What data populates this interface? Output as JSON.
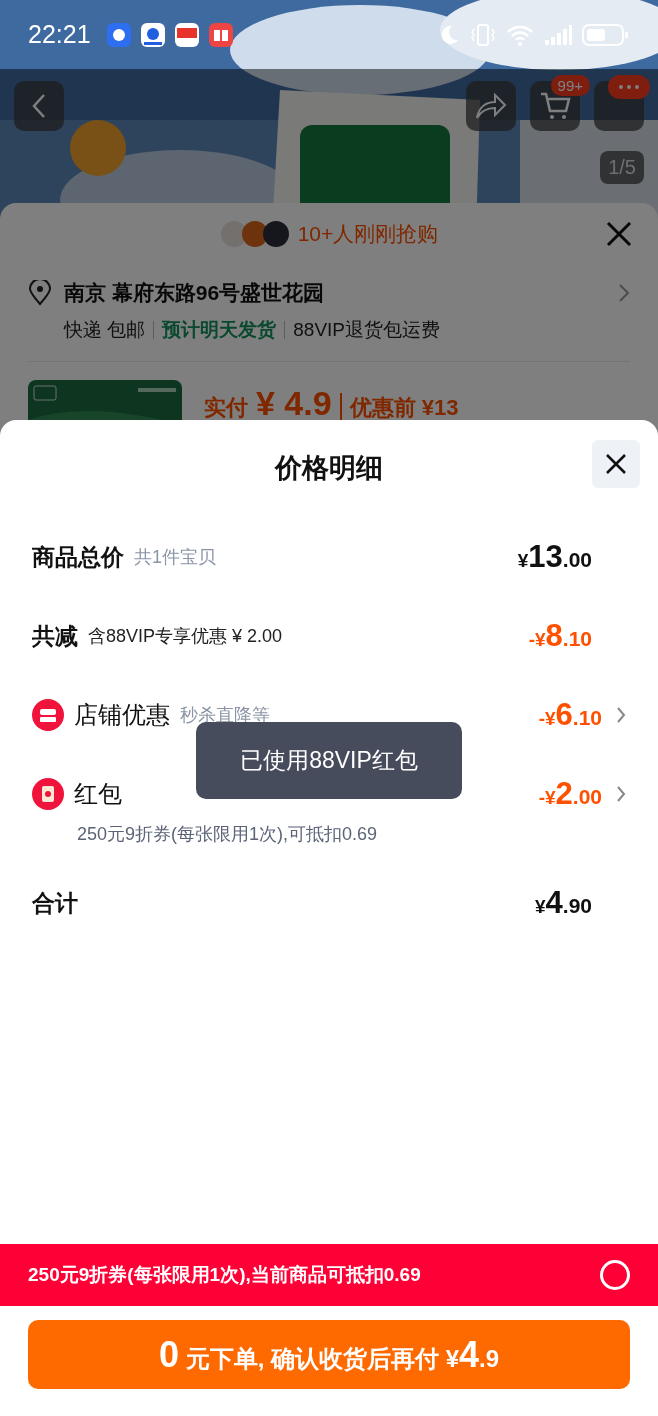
{
  "status_bar": {
    "time": "22:21"
  },
  "header": {
    "cart_badge": "99+",
    "photo_counter": "1/5"
  },
  "order_sheet": {
    "buyers_note": "10+人刚刚抢购",
    "address": "南京 幕府东路96号盛世花园",
    "shipping": [
      {
        "text": "快递 包邮",
        "kind": "plain"
      },
      {
        "text": "预计明天发货",
        "kind": "highlight"
      },
      {
        "text": "88VIP退货包运费",
        "kind": "plain"
      }
    ],
    "paid_label": "实付",
    "paid_price": "¥ 4.9",
    "original_price": "优惠前 ¥13"
  },
  "price_sheet": {
    "title": "价格明细",
    "rows": [
      {
        "kind": "sum",
        "label": "商品总价",
        "note": "共1件宝贝",
        "price": {
          "prefix": "¥",
          "major": "13",
          "minor": ".00"
        }
      },
      {
        "kind": "reduction",
        "label": "共减",
        "note": "含88VIP专享优惠 ¥ 2.00",
        "price": {
          "prefix": "-¥",
          "major": "8",
          "minor": ".10"
        }
      },
      {
        "kind": "store",
        "label": "店铺优惠",
        "note": "秒杀直降等",
        "price": {
          "prefix": "-¥",
          "major": "6",
          "minor": ".10"
        }
      },
      {
        "kind": "packet",
        "label": "红包",
        "detail": "250元9折券(每张限用1次),可抵扣0.69",
        "price": {
          "prefix": "-¥",
          "major": "2",
          "minor": ".00"
        }
      },
      {
        "kind": "total",
        "label": "合计",
        "price": {
          "prefix": "¥",
          "major": "4",
          "minor": ".90"
        }
      }
    ],
    "toast": "已使用88VIP红包"
  },
  "coupon_bar": {
    "text": "250元9折券(每张限用1次),当前商品可抵扣0.69",
    "selected": false
  },
  "confirm_button": {
    "segments": [
      {
        "text": "0",
        "large": true
      },
      {
        "text": " 元下单, 确认收货后再付 ¥",
        "large": false
      },
      {
        "text": "4",
        "large": true
      },
      {
        "text": ".9",
        "large": false
      }
    ]
  }
}
